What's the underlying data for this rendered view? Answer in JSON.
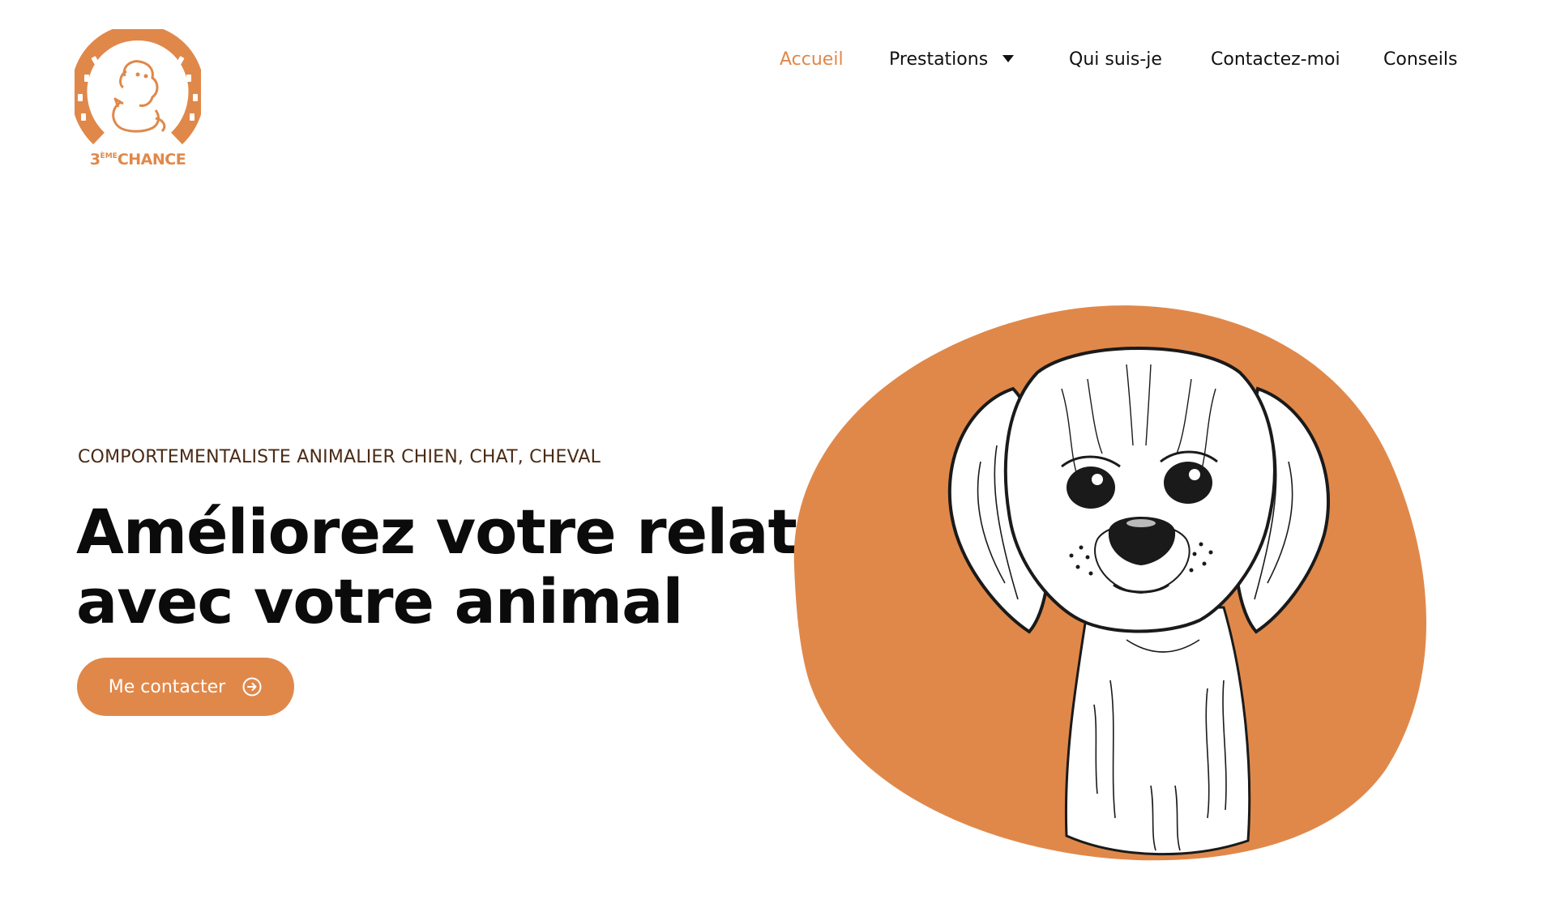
{
  "brand": {
    "logo_text_prefix": "3",
    "logo_text_sup": "ÈME",
    "logo_text_main": "CHANCE",
    "accent_color": "#e0884a"
  },
  "nav": {
    "items": [
      {
        "label": "Accueil",
        "active": true
      },
      {
        "label": "Prestations",
        "has_dropdown": true
      },
      {
        "label": "Qui suis-je"
      },
      {
        "label": "Contactez-moi"
      },
      {
        "label": "Conseils"
      }
    ]
  },
  "hero": {
    "eyebrow": "COMPORTEMENTALISTE ANIMALIER CHIEN, CHAT, CHEVAL",
    "headline_line1": "Améliorez votre relation",
    "headline_line2": "avec votre animal",
    "cta_label": "Me contacter",
    "cta_icon": "arrow-circle-right-icon",
    "illustration": "puppy-illustration"
  }
}
